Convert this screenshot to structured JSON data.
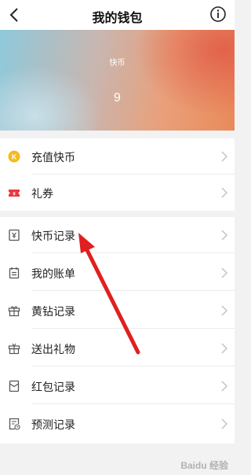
{
  "header": {
    "title": "我的钱包",
    "back_icon": "chevron-left-icon",
    "info_icon": "info-icon"
  },
  "balance": {
    "label": "快币",
    "value": "9"
  },
  "group1": [
    {
      "label": "充值快币",
      "icon": "coin-k-icon"
    },
    {
      "label": "礼券",
      "icon": "coupon-icon"
    }
  ],
  "group2": [
    {
      "label": "快币记录",
      "icon": "yen-receipt-icon"
    },
    {
      "label": "我的账单",
      "icon": "bill-icon"
    },
    {
      "label": "黄钻记录",
      "icon": "gift-box-icon"
    },
    {
      "label": "送出礼物",
      "icon": "gift-send-icon"
    },
    {
      "label": "红包记录",
      "icon": "red-envelope-icon"
    },
    {
      "label": "预测记录",
      "icon": "prediction-icon"
    }
  ],
  "annotation": {
    "color": "#e02020"
  },
  "watermark": {
    "text": "Baidu 经验"
  },
  "colors": {
    "coin": "#f6b91e",
    "coupon": "#e9383f",
    "icon_stroke": "#555555",
    "chevron": "#c4c4c4"
  }
}
